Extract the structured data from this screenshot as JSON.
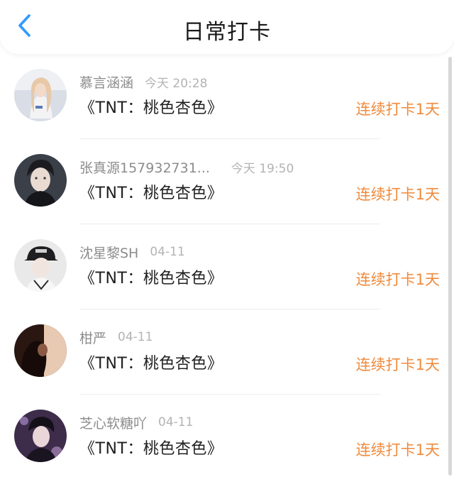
{
  "header": {
    "title": "日常打卡",
    "back_icon": "chevron-left-icon",
    "accent": "#2f9bff"
  },
  "entries": [
    {
      "nickname": "慕言涵涵",
      "time": "今天 20:28",
      "book": "《TNT：桃色杏色》",
      "streak": "连续打卡1天"
    },
    {
      "nickname": "张真源157932731...",
      "time": "今天 19:50",
      "book": "《TNT：桃色杏色》",
      "streak": "连续打卡1天"
    },
    {
      "nickname": "沈星黎SH",
      "time": "04-11",
      "book": "《TNT：桃色杏色》",
      "streak": "连续打卡1天"
    },
    {
      "nickname": "柑严",
      "time": "04-11",
      "book": "《TNT：桃色杏色》",
      "streak": "连续打卡1天"
    },
    {
      "nickname": "芝心软糖吖",
      "time": "04-11",
      "book": "《TNT：桃色杏色》",
      "streak": "连续打卡1天"
    }
  ],
  "colors": {
    "streak": "#f08a3c",
    "nickname": "#8c8c8c",
    "time": "#b3b3b3"
  }
}
